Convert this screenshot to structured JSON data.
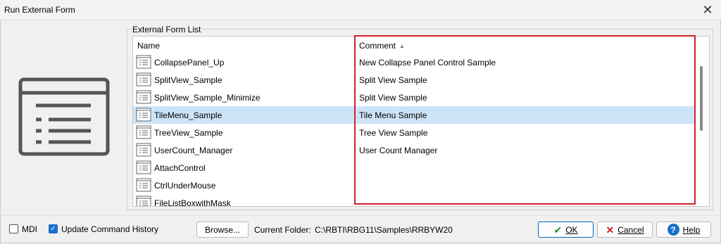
{
  "window": {
    "title": "Run External Form",
    "close_symbol": "✕"
  },
  "group": {
    "label": "External Form List"
  },
  "list": {
    "columns": {
      "name": "Name",
      "comment": "Comment"
    },
    "rows": [
      {
        "name": "CollapsePanel_Up",
        "comment": "New Collapse Panel Control Sample",
        "selected": false
      },
      {
        "name": "SplitView_Sample",
        "comment": "Split View Sample",
        "selected": false
      },
      {
        "name": "SplitView_Sample_Minimize",
        "comment": "Split View Sample",
        "selected": false
      },
      {
        "name": "TileMenu_Sample",
        "comment": "Tile Menu Sample",
        "selected": true
      },
      {
        "name": "TreeView_Sample",
        "comment": "Tree View Sample",
        "selected": false
      },
      {
        "name": "UserCount_Manager",
        "comment": "User Count Manager",
        "selected": false
      },
      {
        "name": "AttachControl",
        "comment": "",
        "selected": false
      },
      {
        "name": "CtrlUnderMouse",
        "comment": "",
        "selected": false
      },
      {
        "name": "FileListBoxwithMask",
        "comment": "",
        "selected": false
      }
    ]
  },
  "options": {
    "mdi": {
      "label": "MDI",
      "checked": false
    },
    "update_history": {
      "label": "Update Command History",
      "checked": true
    }
  },
  "buttons": {
    "browse": "Browse...",
    "ok": "OK",
    "cancel": "Cancel",
    "help": "Help"
  },
  "folder": {
    "label": "Current Folder:",
    "path": "C:\\RBTI\\RBG11\\Samples\\RRBYW20"
  },
  "colors": {
    "selection": "#cce4f7",
    "highlight_border": "#d1202e",
    "accent": "#1a6fc9"
  }
}
